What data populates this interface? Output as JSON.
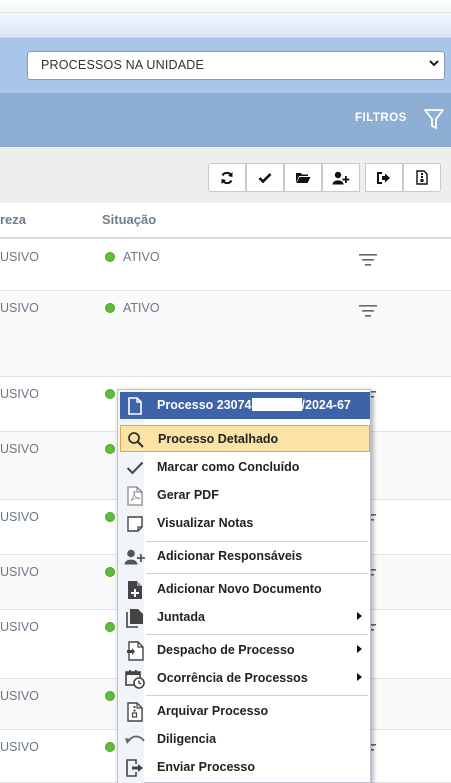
{
  "unit_select": {
    "value": "PROCESSOS NA UNIDADE",
    "options": [
      "PROCESSOS NA UNIDADE"
    ]
  },
  "filter_bar": {
    "label": "FILTROS"
  },
  "toolbar": {
    "icons": [
      "refresh-icon",
      "check-icon",
      "folder-open-icon",
      "add-user-icon",
      "sign-out-icon",
      "document-archive-icon"
    ]
  },
  "table": {
    "headers": {
      "natureza": "reza",
      "situacao": "Situação"
    },
    "rows": [
      {
        "natureza": "USIVO",
        "situacao": "ATIVO"
      },
      {
        "natureza": "USIVO",
        "situacao": "ATIVO"
      },
      {
        "natureza": "USIVO",
        "situacao": ""
      },
      {
        "natureza": "USIVO",
        "situacao": ""
      },
      {
        "natureza": "USIVO",
        "situacao": ""
      },
      {
        "natureza": "USIVO",
        "situacao": ""
      },
      {
        "natureza": "USIVO",
        "situacao": ""
      },
      {
        "natureza": "USIVO",
        "situacao": ""
      },
      {
        "natureza": "USIVO",
        "situacao": ""
      }
    ]
  },
  "context_menu": {
    "title_prefix": "Processo 23074",
    "title_suffix": "/2024-67",
    "items": [
      {
        "label": "Processo Detalhado",
        "icon": "search-icon"
      },
      {
        "label": "Marcar como Concluído",
        "icon": "check-icon"
      },
      {
        "label": "Gerar PDF",
        "icon": "pdf-icon"
      },
      {
        "label": "Visualizar Notas",
        "icon": "note-icon"
      },
      {
        "label": "Adicionar Responsáveis",
        "icon": "add-user-icon"
      },
      {
        "label": "Adicionar Novo Documento",
        "icon": "add-document-icon"
      },
      {
        "label": "Juntada",
        "icon": "documents-icon"
      },
      {
        "label": "Despacho de Processo",
        "icon": "dispatch-icon"
      },
      {
        "label": "Ocorrência de Processos",
        "icon": "calendar-clock-icon"
      },
      {
        "label": "Arquivar Processo",
        "icon": "archive-icon"
      },
      {
        "label": "Diligencia",
        "icon": "undo-icon"
      },
      {
        "label": "Enviar Processo",
        "icon": "send-icon"
      }
    ]
  },
  "colors": {
    "header_bar": "#a9c6ea",
    "filter_bar": "#8eaed3",
    "menu_title_bg": "#3f63a8",
    "highlight": "#fbe3a6",
    "status_dot": "#5cbf3a"
  }
}
